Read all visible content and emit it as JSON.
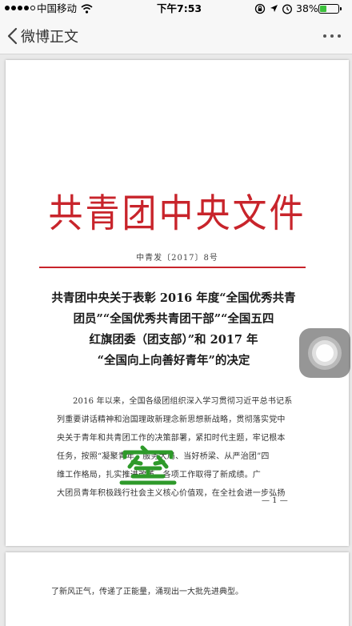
{
  "status_bar": {
    "carrier": "中国移动",
    "time": "下午7:53",
    "battery_percent": "38%",
    "battery_level": 0.38,
    "icons": [
      "signal-dots-icon",
      "wifi-icon",
      "screen-lock-icon",
      "location-icon",
      "alarm-icon",
      "bluetooth-icon",
      "battery-icon"
    ]
  },
  "nav": {
    "back_label": "微博正文",
    "more_icon": "more-dots-icon"
  },
  "document": {
    "header": "共青团中央文件",
    "number": "中青发〔2017〕8号",
    "title_lines": [
      "共青团中央关于表彰 2016 年度“全国优秀共青",
      "团员”“全国优秀共青团干部”“全国五四",
      "红旗团委（团支部）”和 2017 年",
      "“全国向上向善好青年”的决定"
    ],
    "body_lines": [
      "2016 年以来，全国各级团组织深入学习贯彻习近平总书记系",
      "列重要讲话精神和治国理政新理念新思想新战略，贯彻落实党中",
      "央关于青年和共青团工作的决策部署，紧扣时代主题，牢记根本",
      "任务，按照“凝聚青年、服务大局、当好桥梁、从严治团”四",
      "维工作格局，扎实推进改革，各项工作取得了新成绩。广",
      "大团员青年积极践行社会主义核心价值观，在全社会进一步弘扬"
    ],
    "page_number": "— 1 —",
    "page2_line": "了新风正气，传递了正能量，涌现出一大批先进典型。"
  },
  "colors": {
    "header_red": "#c8242b",
    "watermark_green": "#2e9a2a"
  }
}
